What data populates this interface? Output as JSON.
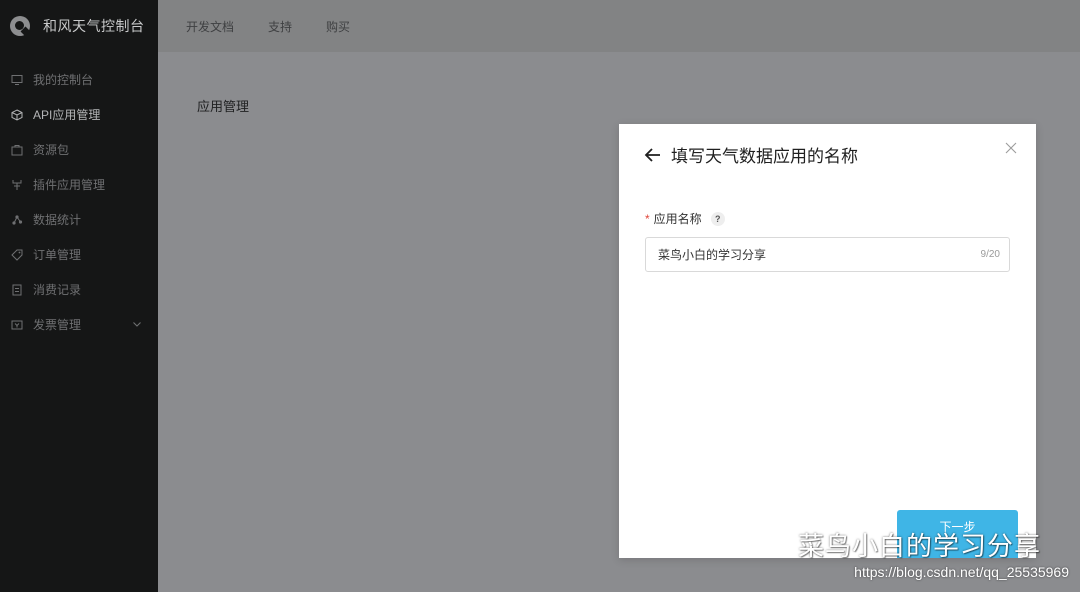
{
  "brand": {
    "title": "和风天气控制台"
  },
  "sidebar": {
    "items": [
      {
        "label": "我的控制台",
        "icon": "monitor-icon"
      },
      {
        "label": "API应用管理",
        "icon": "cube-icon",
        "active": true
      },
      {
        "label": "资源包",
        "icon": "package-icon"
      },
      {
        "label": "插件应用管理",
        "icon": "plugin-icon"
      },
      {
        "label": "数据统计",
        "icon": "stats-icon"
      },
      {
        "label": "订单管理",
        "icon": "tag-icon"
      },
      {
        "label": "消费记录",
        "icon": "receipt-icon"
      },
      {
        "label": "发票管理",
        "icon": "invoice-icon"
      }
    ]
  },
  "topnav": {
    "items": [
      "开发文档",
      "支持",
      "购买"
    ]
  },
  "main": {
    "title": "应用管理"
  },
  "modal": {
    "title": "填写天气数据应用的名称",
    "field_label": "应用名称",
    "required_mark": "*",
    "help_glyph": "?",
    "input_value": "菜鸟小白的学习分享",
    "char_count": "9/20",
    "next_label": "下一步"
  },
  "watermark": {
    "text": "菜鸟小白的学习分享",
    "url": "https://blog.csdn.net/qq_25535969"
  }
}
